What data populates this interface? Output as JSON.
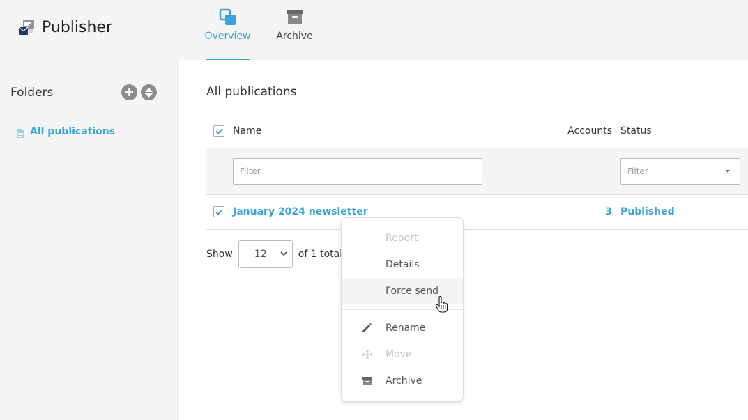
{
  "brand": {
    "title": "Publisher",
    "icon": "publisher-icon"
  },
  "tabs": [
    {
      "label": "Overview",
      "icon": "overview-icon",
      "active": true
    },
    {
      "label": "Archive",
      "icon": "archive-box-icon",
      "active": false
    }
  ],
  "sidebar": {
    "title": "Folders",
    "add_icon": "plus-icon",
    "sort_icon": "sort-icon",
    "items": [
      {
        "label": "All publications",
        "icon": "document-icon"
      }
    ]
  },
  "main": {
    "title": "All publications",
    "columns": {
      "name": "Name",
      "accounts": "Accounts",
      "status": "Status"
    },
    "filters": {
      "name_placeholder": "Filter",
      "status_placeholder": "Filter"
    },
    "rows": [
      {
        "name": "January 2024 newsletter",
        "accounts": "3",
        "status": "Published",
        "checked": true
      }
    ],
    "pager": {
      "show_label": "Show",
      "page_size": "12",
      "total_text": "of 1 total e"
    }
  },
  "context_menu": {
    "items": [
      {
        "label": "Report",
        "enabled": false,
        "icon": ""
      },
      {
        "label": "Details",
        "enabled": true,
        "icon": ""
      },
      {
        "label": "Force send",
        "enabled": true,
        "icon": "",
        "hovered": true
      },
      {
        "label": "Rename",
        "enabled": true,
        "icon": "pencil-icon"
      },
      {
        "label": "Move",
        "enabled": false,
        "icon": "move-arrows-icon"
      },
      {
        "label": "Archive",
        "enabled": true,
        "icon": "archive-box-icon"
      }
    ]
  },
  "colors": {
    "accent": "#37a5d9",
    "text": "#333333",
    "muted": "#c4c4c4",
    "background": "#f5f5f5"
  }
}
